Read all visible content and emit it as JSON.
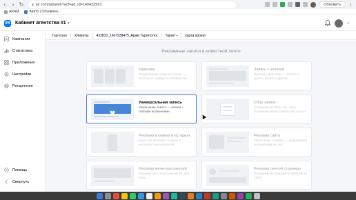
{
  "browser": {
    "url": "vk.com/adsweb?act=ad_id=140432923",
    "update_label": "Обновить",
    "bookmarks": [
      {
        "label": "ARAM",
        "icon": "apps-grid-icon"
      },
      {
        "label": "Авито | Объявлен...",
        "icon": "avito-icon"
      }
    ]
  },
  "vk": {
    "logo_text": "VK",
    "cabinet_title": "Кабинет агентства #1"
  },
  "sidebar": {
    "items": [
      {
        "label": "Кампании",
        "icon": "campaigns-icon"
      },
      {
        "label": "Статистика",
        "icon": "stats-icon"
      },
      {
        "label": "Приложения",
        "icon": "apps-icon"
      },
      {
        "label": "Настройки",
        "icon": "settings-icon"
      },
      {
        "label": "Ретаргетинг",
        "icon": "retargeting-icon"
      }
    ],
    "bottom": [
      {
        "label": "Помощь",
        "icon": "help-icon"
      },
      {
        "label": "Свернуть",
        "icon": "collapse-icon"
      }
    ]
  },
  "breadcrumb": {
    "items": [
      "Таргетинг",
      "Клиенты",
      "423833_1667938475_Арам Таргетолог",
      "Таргет",
      "карта проект"
    ]
  },
  "main": {
    "section_title": "Рекламные записи в новостной ленте",
    "cards": [
      {
        "title": "Карусель",
        "desc": "Продвижение товаров и услуг — несколько слайдов в объявлении",
        "state": "dim"
      },
      {
        "title": "Запись с кнопкой",
        "desc": "Призыв к действию — вступить, купить, узнать и другие",
        "state": "dim"
      },
      {
        "title": "Универсальная запись",
        "desc": "Увеличение охвата — записи с любыми вложениями",
        "state": "active"
      },
      {
        "title": "Сбор заявок",
        "desc": "Соберите контакты тех, кому интересны ваши товары или услуги",
        "state": "dim"
      },
      {
        "title": "Реклама в клипах и историях",
        "desc": "Ваше объявление в клипах и историях пользователей",
        "state": "dim"
      },
      {
        "title": "Реклама сайта",
        "desc": "Увеличение трафика — привлекайте посетителей на сайт",
        "state": "dim"
      },
      {
        "title": "Реклама мини-приложений",
        "desc": "Реклама игр и приложений VK Mini Apps",
        "state": "dim"
      },
      {
        "title": "Реклама личной страницы",
        "desc": "Продвижение профиля и записей на стене",
        "state": "dim"
      }
    ]
  },
  "colors": {
    "accent": "#0077ff",
    "active_border": "#5181b8",
    "muted_text": "#818c99"
  }
}
